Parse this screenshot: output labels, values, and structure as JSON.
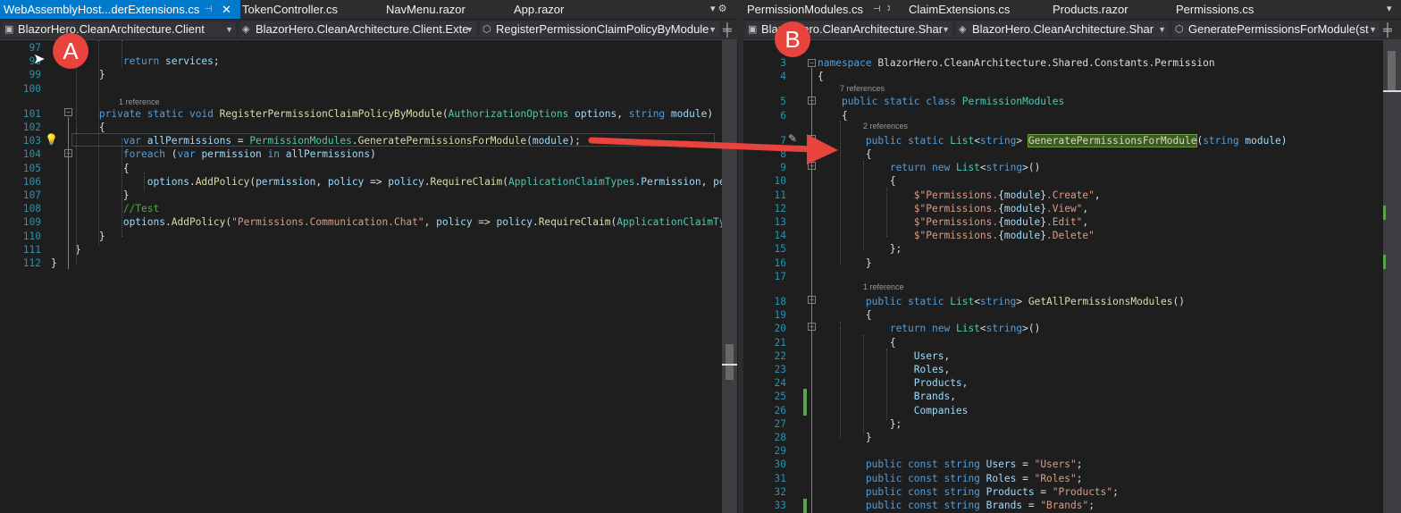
{
  "left_pane": {
    "tabs": [
      {
        "label": "WebAssemblyHost...derExtensions.cs",
        "active": true
      },
      {
        "label": "TokenController.cs",
        "active": false
      },
      {
        "label": "NavMenu.razor",
        "active": false
      },
      {
        "label": "App.razor",
        "active": false
      }
    ],
    "tab_pin_icon": "pin-icon",
    "tab_close_glyph": "✕",
    "tab_tools": "▾ ⚙",
    "nav": {
      "project": "BlazorHero.CleanArchitecture.Client",
      "class": "BlazorHero.CleanArchitecture.Client.Exte",
      "member": "RegisterPermissionClaimPolicyByModule"
    },
    "lines": [
      {
        "n": "97",
        "html": ""
      },
      {
        "n": "98",
        "html": "            <span class='k'>return</span> <span class='v'>services</span>;"
      },
      {
        "n": "99",
        "html": "        }"
      },
      {
        "n": "100",
        "html": ""
      },
      {
        "n": "101",
        "html": "        <span class='k'>private</span> <span class='k'>static</span> <span class='k'>void</span> <span class='m'>RegisterPermissionClaimPolicyByModule</span>(<span class='t'>AuthorizationOptions</span> <span class='v'>options</span>, <span class='k'>string</span> <span class='v'>module</span>)"
      },
      {
        "n": "102",
        "html": "        {"
      },
      {
        "n": "103",
        "html": "            <span class='k'>var</span> <span class='v'>allPermissions</span> = <span class='t'>PermissionModules</span>.<span class='m'>GeneratePermissionsForModule</span>(<span class='v'>module</span>);"
      },
      {
        "n": "104",
        "html": "            <span class='k'>foreach</span> (<span class='k'>var</span> <span class='v'>permission</span> <span class='k'>in</span> <span class='v'>allPermissions</span>)"
      },
      {
        "n": "105",
        "html": "            {"
      },
      {
        "n": "106",
        "html": "                <span class='v'>options</span>.<span class='m'>AddPolicy</span>(<span class='v'>permission</span>, <span class='v'>policy</span> =&gt; <span class='v'>policy</span>.<span class='m'>RequireClaim</span>(<span class='t'>ApplicationClaimTypes</span>.<span class='v'>Permission</span>, <span class='v'>per</span>"
      },
      {
        "n": "107",
        "html": "            }"
      },
      {
        "n": "108",
        "html": "            <span class='c'>//Test</span>"
      },
      {
        "n": "109",
        "html": "            <span class='v'>options</span>.<span class='m'>AddPolicy</span>(<span class='s'>\"Permissions.Communication.Chat\"</span>, <span class='v'>policy</span> =&gt; <span class='v'>policy</span>.<span class='m'>RequireClaim</span>(<span class='t'>ApplicationClaimTyp</span>"
      },
      {
        "n": "110",
        "html": "        }"
      },
      {
        "n": "111",
        "html": "    }"
      },
      {
        "n": "112",
        "html": "}"
      }
    ],
    "reference_lens": "1 reference"
  },
  "right_pane": {
    "tabs": [
      {
        "label": "PermissionModules.cs",
        "active": false
      },
      {
        "label": "ClaimExtensions.cs",
        "active": false
      },
      {
        "label": "Products.razor",
        "active": false
      },
      {
        "label": "Permissions.cs",
        "active": false
      }
    ],
    "tab_close_glyph": "✕",
    "tab_tools": "▾",
    "nav": {
      "project": "BlazorHero.CleanArchitecture.Shar",
      "class": "BlazorHero.CleanArchitecture.Shar",
      "member": "GeneratePermissionsForModule(st"
    },
    "lines": [
      {
        "n": "3",
        "html": "<span class='k'>namespace</span> <span class='p'>BlazorHero.CleanArchitecture.Shared.Constants.Permission</span>"
      },
      {
        "n": "4",
        "html": "{"
      },
      {
        "n": "5",
        "html": "    <span class='k'>public</span> <span class='k'>static</span> <span class='k'>class</span> <span class='t'>PermissionModules</span>"
      },
      {
        "n": "6",
        "html": "    {"
      },
      {
        "n": "7",
        "html": "        <span class='k'>public</span> <span class='k'>static</span> <span class='t'>List</span>&lt;<span class='k'>string</span>&gt; <span class='m hl'>GeneratePermissionsForModule</span>(<span class='k'>string</span> <span class='v'>module</span>)"
      },
      {
        "n": "8",
        "html": "        {"
      },
      {
        "n": "9",
        "html": "            <span class='k'>return</span> <span class='k'>new</span> <span class='t'>List</span>&lt;<span class='k'>string</span>&gt;()"
      },
      {
        "n": "10",
        "html": "            {"
      },
      {
        "n": "11",
        "html": "                <span class='s'>$\"Permissions.</span>{<span class='v'>module</span>}<span class='s'>.Create\"</span>,"
      },
      {
        "n": "12",
        "html": "                <span class='s'>$\"Permissions.</span>{<span class='v'>module</span>}<span class='s'>.View\"</span>,"
      },
      {
        "n": "13",
        "html": "                <span class='s'>$\"Permissions.</span>{<span class='v'>module</span>}<span class='s'>.Edit\"</span>,"
      },
      {
        "n": "14",
        "html": "                <span class='s'>$\"Permissions.</span>{<span class='v'>module</span>}<span class='s'>.Delete\"</span>"
      },
      {
        "n": "15",
        "html": "            };"
      },
      {
        "n": "16",
        "html": "        }"
      },
      {
        "n": "17",
        "html": ""
      },
      {
        "n": "18",
        "html": "        <span class='k'>public</span> <span class='k'>static</span> <span class='t'>List</span>&lt;<span class='k'>string</span>&gt; <span class='m'>GetAllPermissionsModules</span>()"
      },
      {
        "n": "19",
        "html": "        {"
      },
      {
        "n": "20",
        "html": "            <span class='k'>return</span> <span class='k'>new</span> <span class='t'>List</span>&lt;<span class='k'>string</span>&gt;()"
      },
      {
        "n": "21",
        "html": "            {"
      },
      {
        "n": "22",
        "html": "                <span class='v'>Users</span>,"
      },
      {
        "n": "23",
        "html": "                <span class='v'>Roles</span>,"
      },
      {
        "n": "24",
        "html": "                <span class='v'>Products</span>,"
      },
      {
        "n": "25",
        "html": "                <span class='v'>Brands</span>,"
      },
      {
        "n": "26",
        "html": "                <span class='v'>Companies</span>"
      },
      {
        "n": "27",
        "html": "            };"
      },
      {
        "n": "28",
        "html": "        }"
      },
      {
        "n": "29",
        "html": ""
      },
      {
        "n": "30",
        "html": "        <span class='k'>public</span> <span class='k'>const</span> <span class='k'>string</span> <span class='v'>Users</span> = <span class='s'>\"Users\"</span>;"
      },
      {
        "n": "31",
        "html": "        <span class='k'>public</span> <span class='k'>const</span> <span class='k'>string</span> <span class='v'>Roles</span> = <span class='s'>\"Roles\"</span>;"
      },
      {
        "n": "32",
        "html": "        <span class='k'>public</span> <span class='k'>const</span> <span class='k'>string</span> <span class='v'>Products</span> = <span class='s'>\"Products\"</span>;"
      },
      {
        "n": "33",
        "html": "        <span class='k'>public</span> <span class='k'>const</span> <span class='k'>string</span> <span class='v'>Brands</span> = <span class='s'>\"Brands\"</span>;"
      }
    ],
    "reference_lenses": [
      "7 references",
      "2 references",
      "1 reference"
    ]
  },
  "annotations": {
    "marker_a": "A",
    "marker_b": "B",
    "arrow_color": "#e8433d"
  }
}
